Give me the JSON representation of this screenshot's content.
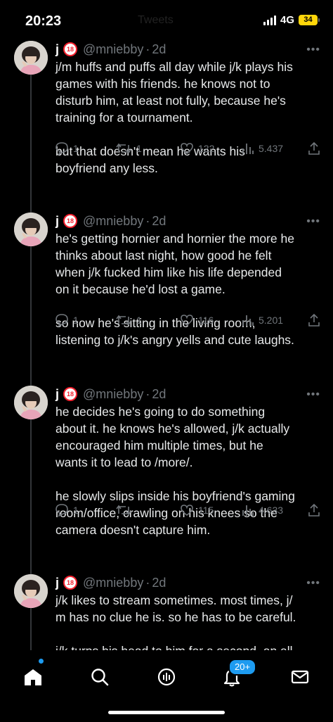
{
  "status": {
    "time": "20:23",
    "ghost_title": "Tweets",
    "network": "4G",
    "battery": "34"
  },
  "tweets": [
    {
      "name": "j",
      "badge": "18",
      "handle": "@mniebby",
      "time": "2d",
      "paragraphs": [
        "j/m huffs and puffs all day while j/k plays his\ngames with his friends. he knows not to\ndisturb him, at least not fully, because he's\ntraining for a tournament.",
        "but that doesn't mean he wants his\nboyfriend any less."
      ],
      "replies": "1",
      "retweets": "1",
      "likes": "122",
      "views": "5.437"
    },
    {
      "name": "j",
      "badge": "18",
      "handle": "@mniebby",
      "time": "2d",
      "paragraphs": [
        "he's getting hornier and hornier the more he\nthinks about last night, how good he felt\nwhen j/k fucked him like his life depended\non it because he'd lost a game.",
        "so now he's sitting in the living room,\nlistening to j/k's angry yells and cute laughs."
      ],
      "replies": "1",
      "retweets": "1",
      "likes": "116",
      "views": "5.201"
    },
    {
      "name": "j",
      "badge": "18",
      "handle": "@mniebby",
      "time": "2d",
      "paragraphs": [
        "he decides he's going to do something\nabout it. he knows he's allowed, j/k actually\nencouraged him multiple times, but he\nwants it to lead to /more/.",
        "he slowly slips inside his boyfriend's gaming\nroom/office, crawling on his knees so the\ncamera doesn't capture him."
      ],
      "replies": "1",
      "retweets": "",
      "likes": "115",
      "views": "4.633"
    },
    {
      "name": "j",
      "badge": "18",
      "handle": "@mniebby",
      "time": "2d",
      "paragraphs": [
        "j/k likes to stream sometimes. most times, j/\nm has no clue he is. so he has to be careful.",
        "j/k turns his head to him for a second, an all-"
      ]
    }
  ],
  "tabbar": {
    "notifications_badge": "20+"
  },
  "colors": {
    "accent": "#1d9bf0",
    "muted": "#71767b",
    "badge_red": "#f4212e",
    "battery": "#ffd60a"
  },
  "icons": [
    "reply-icon",
    "retweet-icon",
    "like-icon",
    "views-icon",
    "share-icon",
    "more-icon",
    "home-icon",
    "search-icon",
    "spaces-icon",
    "notifications-icon",
    "messages-icon"
  ]
}
